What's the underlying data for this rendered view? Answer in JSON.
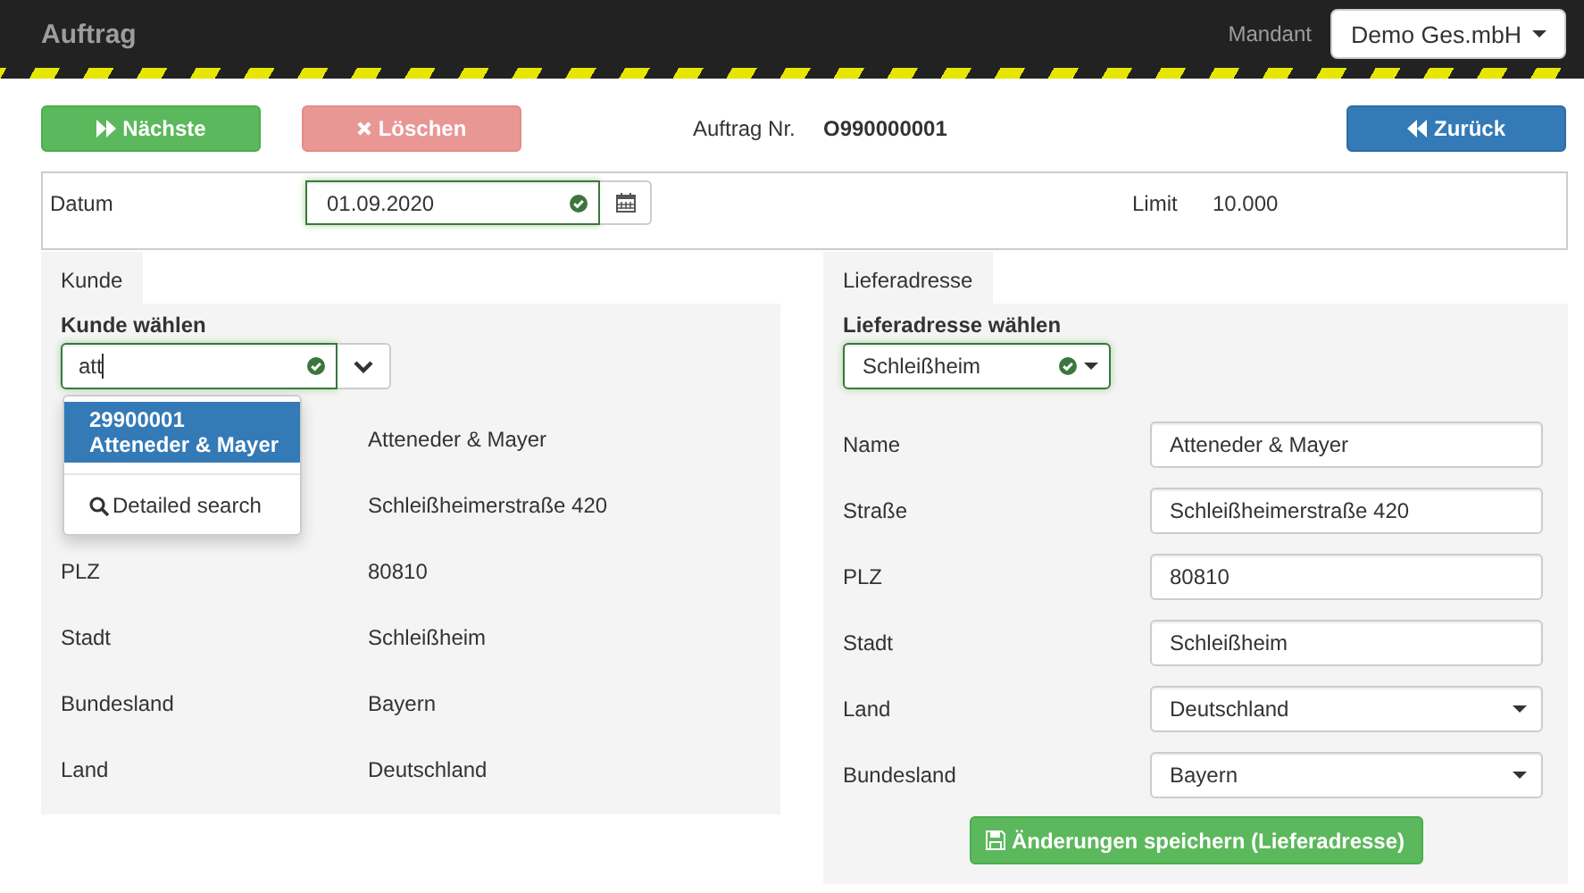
{
  "header": {
    "title": "Auftrag",
    "mandant_label": "Mandant",
    "mandant_value": "Demo Ges.mbH"
  },
  "actions": {
    "buttons": [
      {
        "kind": "next",
        "label": "Nächste",
        "disabled": false
      },
      {
        "kind": "delete",
        "label": "Löschen",
        "disabled": true
      },
      {
        "kind": "back",
        "label": "Zurück",
        "disabled": false
      }
    ],
    "order_label": "Auftrag Nr.",
    "order_number": "O990000001"
  },
  "date_row": {
    "label": "Datum",
    "value": "01.09.2020",
    "valid": true,
    "limit_label": "Limit",
    "limit_value": "10.000"
  },
  "customer": {
    "tab": "Kunde",
    "select_label": "Kunde wählen",
    "search_value": "att",
    "valid": true,
    "suggestions": [
      {
        "number": "29900001",
        "name": "Atteneder & Mayer",
        "selected": true
      }
    ],
    "detailed_search": "Detailed search",
    "fields": [
      {
        "value": "Atteneder & Mayer"
      },
      {
        "value": "Schleißheimerstraße 420"
      },
      {
        "label": "PLZ",
        "value": "80810"
      },
      {
        "label": "Stadt",
        "value": "Schleißheim"
      },
      {
        "label": "Bundesland",
        "value": "Bayern"
      },
      {
        "label": "Land",
        "value": "Deutschland"
      }
    ]
  },
  "delivery": {
    "tab": "Lieferadresse",
    "select_label": "Lieferadresse wählen",
    "select_value": "Schleißheim",
    "valid": true,
    "fields": [
      {
        "kind": "text",
        "label": "Name",
        "value": "Atteneder & Mayer"
      },
      {
        "kind": "text",
        "label": "Straße",
        "value": "Schleißheimerstraße 420"
      },
      {
        "kind": "text",
        "label": "PLZ",
        "value": "80810"
      },
      {
        "kind": "text",
        "label": "Stadt",
        "value": "Schleißheim"
      },
      {
        "kind": "select",
        "label": "Land",
        "value": "Deutschland"
      },
      {
        "kind": "select",
        "label": "Bundesland",
        "value": "Bayern"
      }
    ],
    "save_button": "Änderungen speichern (Lieferadresse)"
  }
}
